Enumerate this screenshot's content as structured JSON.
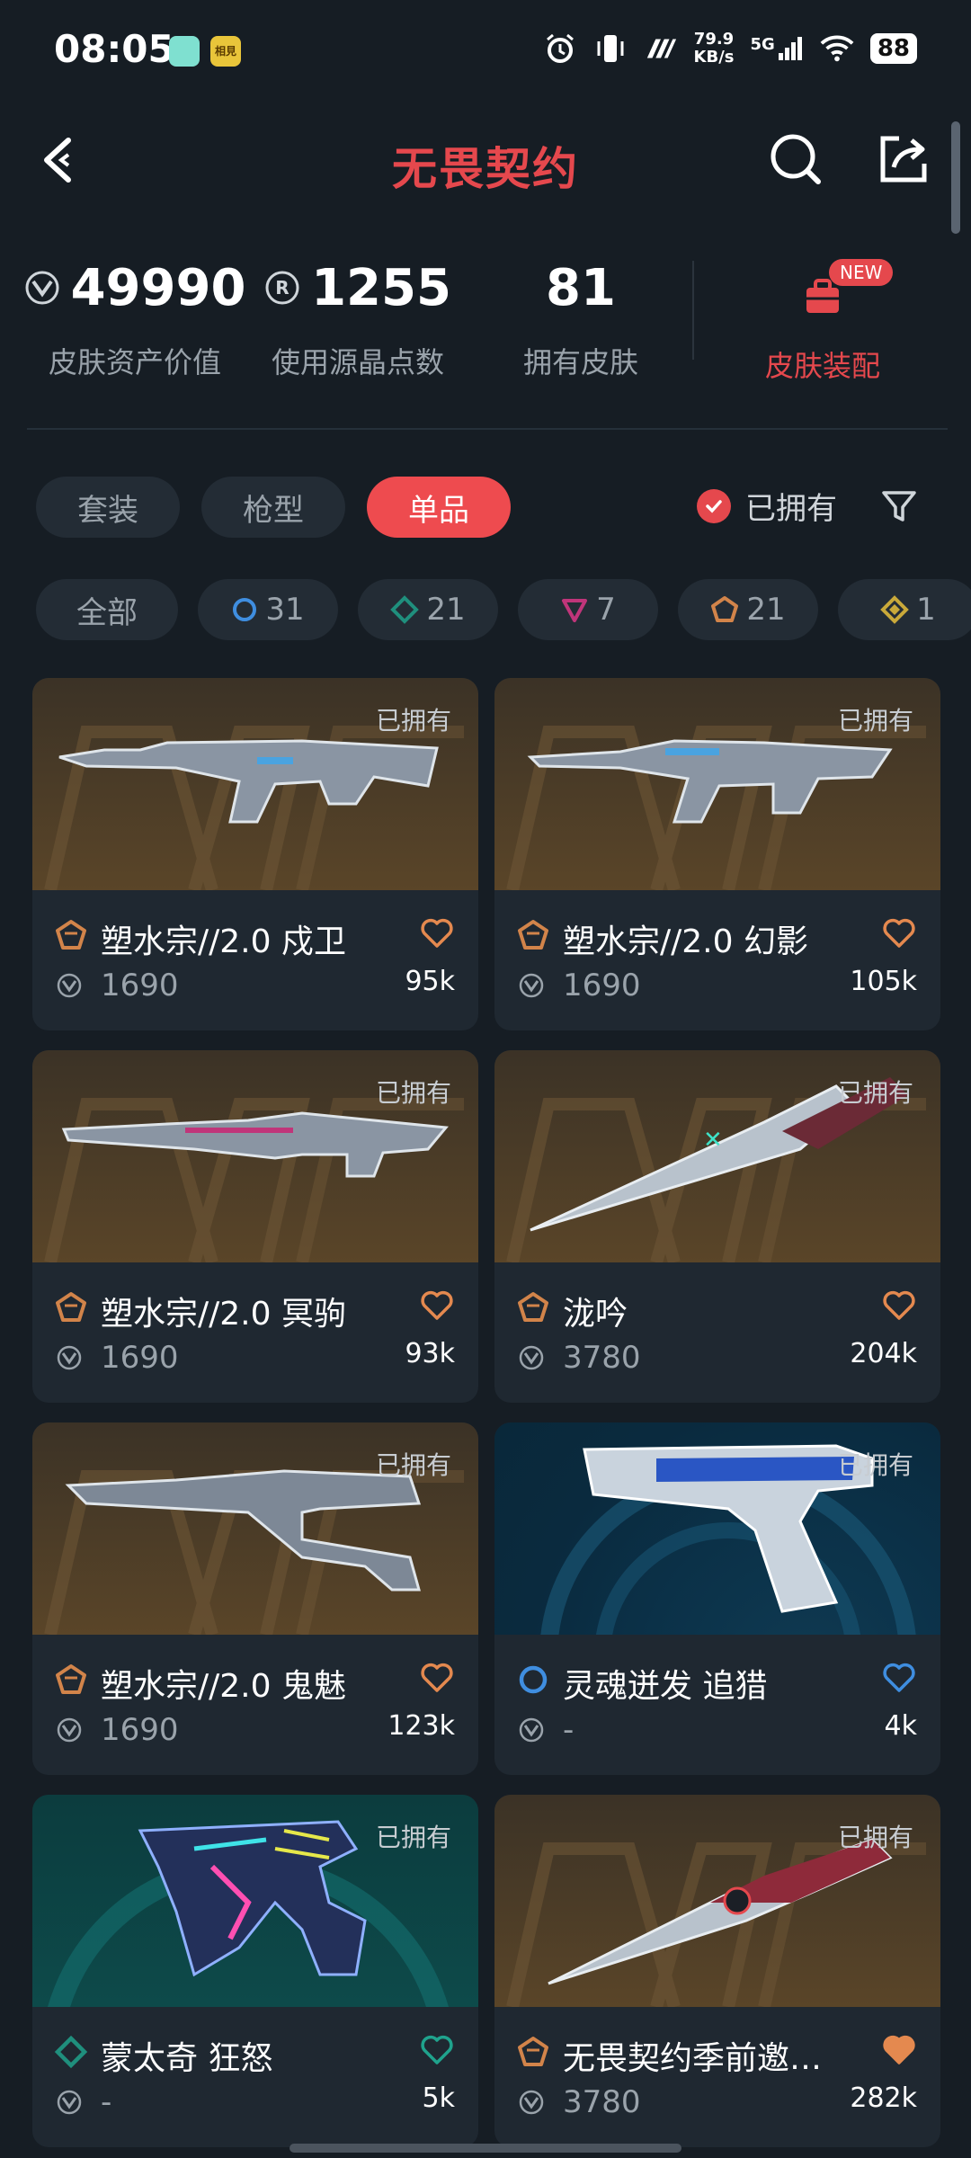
{
  "status_bar": {
    "time": "08:05",
    "app_badge": "相見",
    "net_speed_value": "79.9",
    "net_speed_unit": "KB/s",
    "network": "5G",
    "battery": "88"
  },
  "header": {
    "title": "无畏契约"
  },
  "stats": [
    {
      "icon": "valorant-point-icon",
      "value": "49990",
      "label": "皮肤资产价值"
    },
    {
      "icon": "radianite-icon",
      "value": "1255",
      "label": "使用源晶点数"
    },
    {
      "value": "81",
      "label": "拥有皮肤"
    }
  ],
  "loadout": {
    "label": "皮肤装配",
    "badge": "NEW"
  },
  "tabs": [
    {
      "label": "套装",
      "active": false
    },
    {
      "label": "枪型",
      "active": false
    },
    {
      "label": "单品",
      "active": true
    }
  ],
  "owned_filter": {
    "label": "已拥有",
    "checked": true
  },
  "rarity_chips": [
    {
      "label": "全部"
    },
    {
      "tier": "select",
      "count": "31",
      "color": "#3f8ee0"
    },
    {
      "tier": "deluxe",
      "count": "21",
      "color": "#1f8f7d"
    },
    {
      "tier": "premium",
      "count": "7",
      "color": "#c0357a"
    },
    {
      "tier": "exclusive",
      "count": "21",
      "color": "#d2844a"
    },
    {
      "tier": "ultra",
      "count": "1",
      "color": "#c9a93a"
    }
  ],
  "items": [
    {
      "name": "塑水宗//2.0 戍卫",
      "price": "1690",
      "likes": "95k",
      "owned_tag": "已拥有",
      "tier": "exclusive",
      "bg": "brown",
      "heart_filled": false
    },
    {
      "name": "塑水宗//2.0 幻影",
      "price": "1690",
      "likes": "105k",
      "owned_tag": "已拥有",
      "tier": "exclusive",
      "bg": "brown",
      "heart_filled": false
    },
    {
      "name": "塑水宗//2.0 冥驹",
      "price": "1690",
      "likes": "93k",
      "owned_tag": "已拥有",
      "tier": "exclusive",
      "bg": "brown",
      "heart_filled": false
    },
    {
      "name": "泷吟",
      "price": "3780",
      "likes": "204k",
      "owned_tag": "已拥有",
      "tier": "exclusive",
      "bg": "brown",
      "heart_filled": false
    },
    {
      "name": "塑水宗//2.0 鬼魅",
      "price": "1690",
      "likes": "123k",
      "owned_tag": "已拥有",
      "tier": "exclusive",
      "bg": "brown",
      "heart_filled": false
    },
    {
      "name": "灵魂迸发 追猎",
      "price": "-",
      "likes": "4k",
      "owned_tag": "已拥有",
      "tier": "select",
      "bg": "blue",
      "heart_filled": false
    },
    {
      "name": "蒙太奇 狂怒",
      "price": "-",
      "likes": "5k",
      "owned_tag": "已拥有",
      "tier": "deluxe",
      "bg": "teal",
      "heart_filled": false
    },
    {
      "name": "无畏契约季前邀…",
      "price": "3780",
      "likes": "282k",
      "owned_tag": "已拥有",
      "tier": "exclusive",
      "bg": "brown",
      "heart_filled": true
    }
  ],
  "colors": {
    "accent": "#e5484d",
    "background": "#161d24",
    "card": "#1f2831",
    "exclusive": "#d2844a",
    "select": "#3f8ee0",
    "deluxe": "#1f8f7d"
  }
}
